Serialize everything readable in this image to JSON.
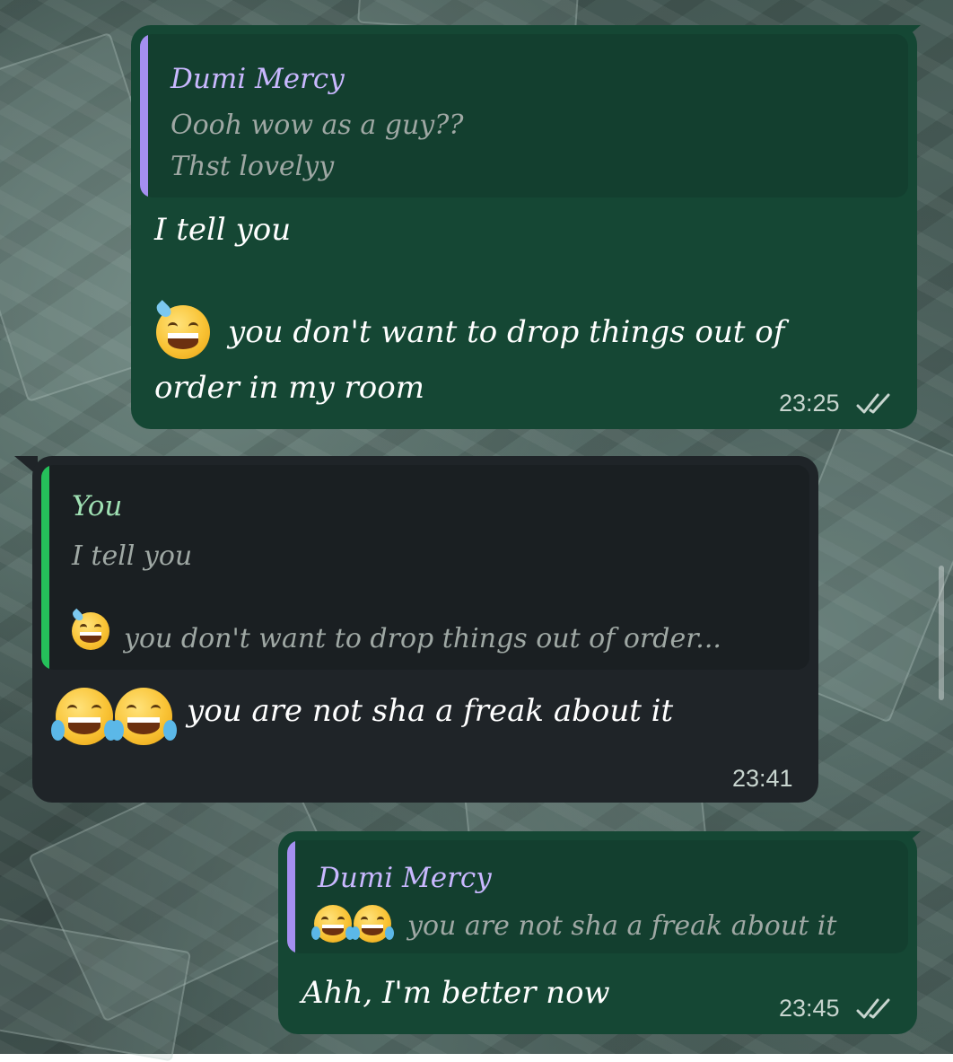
{
  "messages": [
    {
      "direction": "outgoing",
      "reply_to": {
        "author": "Dumi Mercy",
        "lines": [
          "Oooh wow as a guy??",
          "Thst lovelyy"
        ]
      },
      "lines": [
        "I tell you",
        "",
        "you don't want to drop things out of",
        "order in my room"
      ],
      "emoji": [
        "sweat-smile-icon"
      ],
      "time": "23:25",
      "status": "read"
    },
    {
      "direction": "incoming",
      "reply_to": {
        "author": "You",
        "lines": [
          "I tell you",
          "",
          "you don't want to drop things out of order..."
        ]
      },
      "lines": [
        "you are not sha a freak about it"
      ],
      "emoji": [
        "tears-of-joy-icon",
        "tears-of-joy-icon"
      ],
      "time": "23:41"
    },
    {
      "direction": "outgoing",
      "reply_to": {
        "author": "Dumi Mercy",
        "lines": [
          "you are not sha a freak about it"
        ]
      },
      "lines": [
        "Ahh, I'm better now"
      ],
      "emoji": [],
      "time": "23:45",
      "status": "read"
    }
  ],
  "colors": {
    "outgoing_bubble": "#154734",
    "incoming_bubble": "#1f2428",
    "quote_bar_other": "#a58ff0",
    "quote_bar_you": "#25c05a",
    "quote_name_other": "#c9b8ff",
    "quote_name_you": "#9fe0b3",
    "read_ticks": "#c8d5cf"
  }
}
